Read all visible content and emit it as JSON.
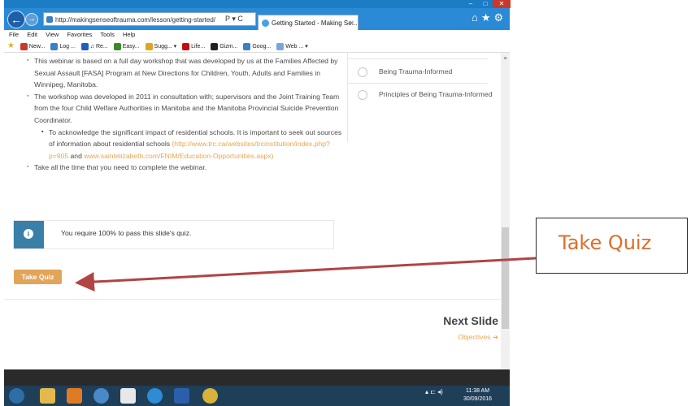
{
  "browser": {
    "url": "http://makingsenseoftrauma.com/lesson/getting-started/",
    "tab_title": "Getting Started - Making Se...",
    "tab_close": "✕",
    "window_controls": [
      "–",
      "□",
      "✕"
    ],
    "address_tools": "P ▾ C",
    "right_icons": "⌂★⚙",
    "menu": [
      "File",
      "Edit",
      "View",
      "Favorites",
      "Tools",
      "Help"
    ],
    "favorites": [
      {
        "label": "New...",
        "color": "#c9392b"
      },
      {
        "label": "Log ...",
        "color": "#3b80c4"
      },
      {
        "label": "♫ Re...",
        "color": "#1f5fbf"
      },
      {
        "label": "Easy...",
        "color": "#3a8a2a"
      },
      {
        "label": "Sugg... ▾",
        "color": "#e0a520"
      },
      {
        "label": "Life...",
        "color": "#c11010"
      },
      {
        "label": "Gizm...",
        "color": "#222222"
      },
      {
        "label": "Goog...",
        "color": "#3b80c4"
      },
      {
        "label": "Web ... ▾",
        "color": "#7aa5d6"
      }
    ]
  },
  "content": {
    "bullets": [
      "This webinar is based on a full day workshop that was developed by us at the Families Affected by Sexual Assault [FASA] Program at New Directions for Children, Youth, Adults and Families in Winnipeg, Manitoba.",
      "The workshop was developed in 2011 in consultation with; supervisors and the Joint Training Team from the four Child Welfare Authorities in Manitoba and the Manitoba Provincial Suicide Prevention Coordinator."
    ],
    "sub_bullet": {
      "text": "To acknowledge the significant impact of residential schools. It is important to seek out sources of information about residential schools",
      "link1": "(http://www.trc.ca/websites/trcinstitution/index.php?p=905",
      "and": "and",
      "link2": "www.saintelizabeth.com/FNIM/Education-Opportunities.aspx)"
    },
    "last_bullet": "Take all the time that you need to complete the webinar."
  },
  "sidebar": {
    "items": [
      "Being Trauma-Informed",
      "Principles of Being Trauma-Informed"
    ]
  },
  "info": {
    "icon": "i",
    "text": "You require 100% to pass this slide's quiz."
  },
  "quiz_button": "Take Quiz",
  "next": {
    "title": "Next Slide",
    "subtitle": "Objectives ➔"
  },
  "tray": {
    "icons": "▴ ⊏ ◂)",
    "time": "11:38 AM",
    "date": "30/09/2016"
  },
  "taskbar_apps": [
    {
      "name": "start",
      "color": "#2b6ea8"
    },
    {
      "name": "explorer",
      "color": "#e3b94c"
    },
    {
      "name": "outlook",
      "color": "#e07b25"
    },
    {
      "name": "itunes",
      "color": "#4a89c7"
    },
    {
      "name": "photos",
      "color": "#e8e8e8"
    },
    {
      "name": "ie",
      "color": "#2e8bd6"
    },
    {
      "name": "word",
      "color": "#2b5faa"
    },
    {
      "name": "chrome",
      "color": "#d8b23a"
    }
  ],
  "callout": {
    "text": "Take Quiz"
  },
  "colors": {
    "accent": "#e2a458",
    "arrow": "#b24444",
    "info": "#3a7fa8"
  }
}
